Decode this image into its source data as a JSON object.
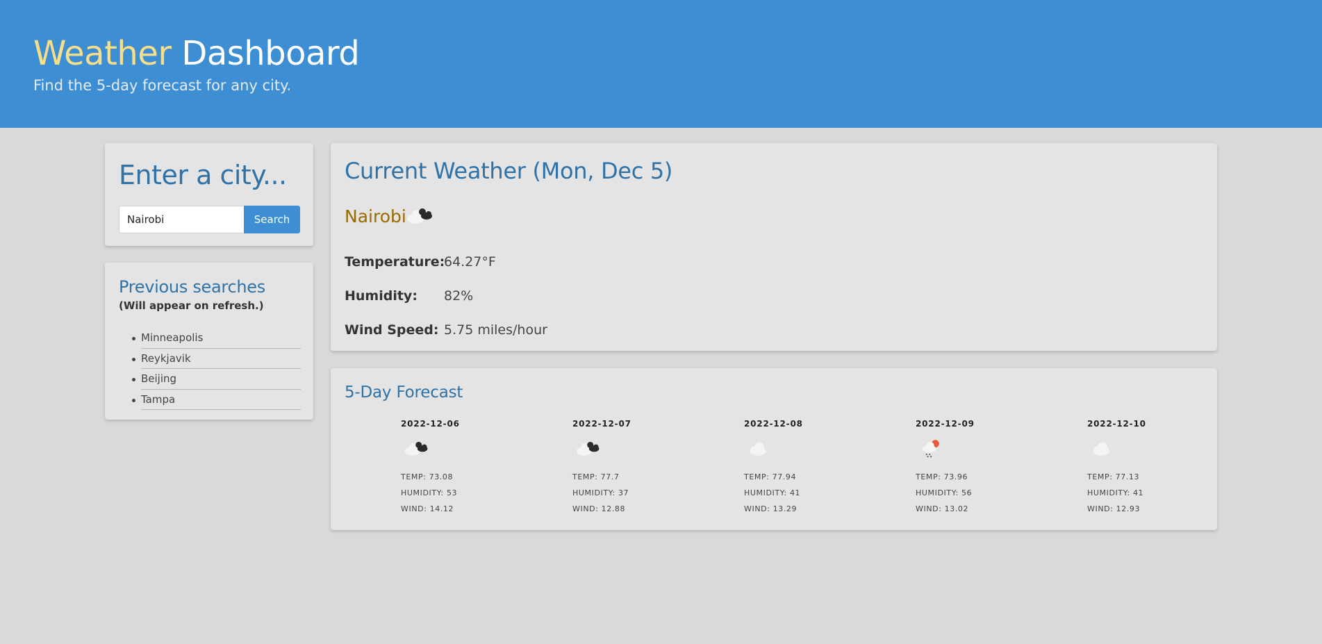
{
  "header": {
    "title_word_1": "Weather",
    "title_word_2": "Dashboard",
    "subtitle": "Find the 5-day forecast for any city.",
    "background": "#3e8ed3"
  },
  "search": {
    "heading": "Enter a city...",
    "input_value": "Nairobi",
    "button_label": "Search"
  },
  "previous": {
    "heading": "Previous searches",
    "subheading": "(Will appear on refresh.)",
    "items": [
      {
        "label": "Minneapolis"
      },
      {
        "label": "Reykjavik"
      },
      {
        "label": "Beijing"
      },
      {
        "label": "Tampa"
      }
    ]
  },
  "current": {
    "heading": "Current Weather (Mon, Dec 5)",
    "city": "Nairobi",
    "icon": "broken-clouds-icon",
    "temperature_label": "Temperature:",
    "temperature_value": "64.27°F",
    "humidity_label": "Humidity:",
    "humidity_value": "82%",
    "wind_label": "Wind Speed:",
    "wind_value": "5.75 miles/hour"
  },
  "forecast": {
    "heading": "5-Day Forecast",
    "days": [
      {
        "date": "2022-12-06",
        "icon": "broken-clouds-icon",
        "temp": "TEMP: 73.08",
        "humidity": "HUMIDITY: 53",
        "wind": "WIND: 14.12"
      },
      {
        "date": "2022-12-07",
        "icon": "broken-clouds-icon",
        "temp": "TEMP: 77.7",
        "humidity": "HUMIDITY: 37",
        "wind": "WIND: 12.88"
      },
      {
        "date": "2022-12-08",
        "icon": "cloud-icon",
        "temp": "TEMP: 77.94",
        "humidity": "HUMIDITY: 41",
        "wind": "WIND: 13.29"
      },
      {
        "date": "2022-12-09",
        "icon": "rain-sun-icon",
        "temp": "TEMP: 73.96",
        "humidity": "HUMIDITY: 56",
        "wind": "WIND: 13.02"
      },
      {
        "date": "2022-12-10",
        "icon": "cloud-icon",
        "temp": "TEMP: 77.13",
        "humidity": "HUMIDITY: 41",
        "wind": "WIND: 12.93"
      }
    ]
  },
  "colors": {
    "accent": "#3e8ed3",
    "heading": "#2f72a8",
    "title_highlight": "#f7df8a",
    "city": "#9b6a00",
    "page_bg": "#d9d9d9",
    "card_bg": "#e4e4e4"
  }
}
